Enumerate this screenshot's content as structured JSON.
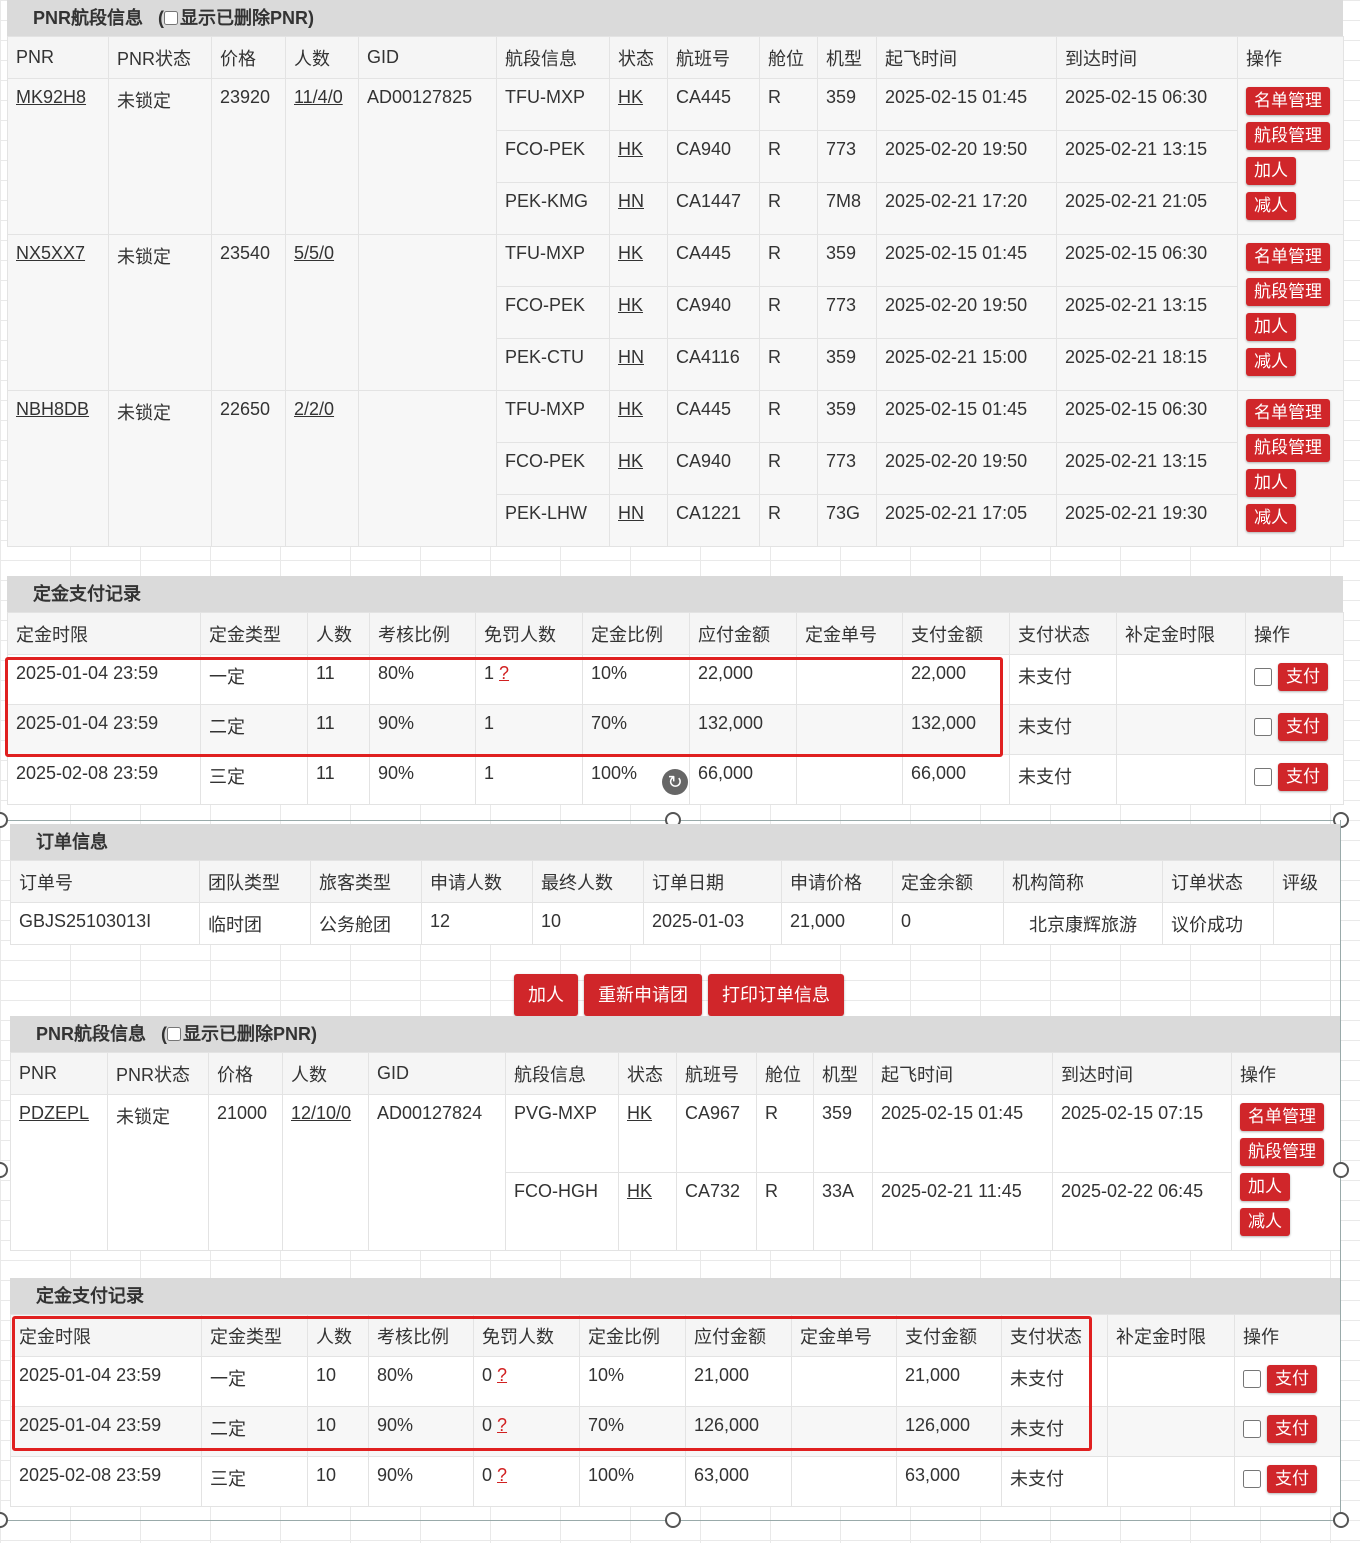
{
  "pnr1": {
    "title": "PNR航段信息",
    "show_deleted": "显示已删除PNR)",
    "headers": [
      "PNR",
      "PNR状态",
      "价格",
      "人数",
      "GID",
      "航段信息",
      "状态",
      "航班号",
      "舱位",
      "机型",
      "起飞时间",
      "到达时间",
      "操作"
    ],
    "groups": [
      {
        "pnr": "MK92H8",
        "status": "未锁定",
        "price": "23920",
        "count": "11/4/0",
        "gid": "AD00127825",
        "segs": [
          [
            "TFU-MXP",
            "HK",
            "CA445",
            "R",
            "359",
            "2025-02-15 01:45",
            "2025-02-15 06:30"
          ],
          [
            "FCO-PEK",
            "HK",
            "CA940",
            "R",
            "773",
            "2025-02-20 19:50",
            "2025-02-21 13:15"
          ],
          [
            "PEK-KMG",
            "HN",
            "CA1447",
            "R",
            "7M8",
            "2025-02-21 17:20",
            "2025-02-21 21:05"
          ]
        ]
      },
      {
        "pnr": "NX5XX7",
        "status": "未锁定",
        "price": "23540",
        "count": "5/5/0",
        "gid": "",
        "segs": [
          [
            "TFU-MXP",
            "HK",
            "CA445",
            "R",
            "359",
            "2025-02-15 01:45",
            "2025-02-15 06:30"
          ],
          [
            "FCO-PEK",
            "HK",
            "CA940",
            "R",
            "773",
            "2025-02-20 19:50",
            "2025-02-21 13:15"
          ],
          [
            "PEK-CTU",
            "HN",
            "CA4116",
            "R",
            "359",
            "2025-02-21 15:00",
            "2025-02-21 18:15"
          ]
        ]
      },
      {
        "pnr": "NBH8DB",
        "status": "未锁定",
        "price": "22650",
        "count": "2/2/0",
        "gid": "",
        "segs": [
          [
            "TFU-MXP",
            "HK",
            "CA445",
            "R",
            "359",
            "2025-02-15 01:45",
            "2025-02-15 06:30"
          ],
          [
            "FCO-PEK",
            "HK",
            "CA940",
            "R",
            "773",
            "2025-02-20 19:50",
            "2025-02-21 13:15"
          ],
          [
            "PEK-LHW",
            "HN",
            "CA1221",
            "R",
            "73G",
            "2025-02-21 17:05",
            "2025-02-21 19:30"
          ]
        ]
      }
    ],
    "ops": [
      "名单管理",
      "航段管理",
      "加人",
      "减人"
    ]
  },
  "deposit1": {
    "title": "定金支付记录",
    "headers": [
      "定金时限",
      "定金类型",
      "人数",
      "考核比例",
      "免罚人数",
      "定金比例",
      "应付金额",
      "定金单号",
      "支付金额",
      "支付状态",
      "补定金时限",
      "操作"
    ],
    "rows": [
      [
        "2025-01-04 23:59",
        "一定",
        "11",
        "80%",
        "1",
        "10%",
        "22,000",
        "",
        "22,000",
        "未支付",
        "",
        ""
      ],
      [
        "2025-01-04 23:59",
        "二定",
        "11",
        "90%",
        "1",
        "70%",
        "132,000",
        "",
        "132,000",
        "未支付",
        "",
        ""
      ],
      [
        "2025-02-08 23:59",
        "三定",
        "11",
        "90%",
        "1",
        "100%",
        "66,000",
        "",
        "66,000",
        "未支付",
        "",
        ""
      ]
    ],
    "q_mark": "?",
    "pay_label": "支付"
  },
  "order": {
    "title": "订单信息",
    "headers": [
      "订单号",
      "团队类型",
      "旅客类型",
      "申请人数",
      "最终人数",
      "订单日期",
      "申请价格",
      "定金余额",
      "机构简称",
      "订单状态",
      "评级"
    ],
    "row": [
      "GBJS25103013I",
      "临时团",
      "公务舱团",
      "12",
      "10",
      "2025-01-03",
      "21,000",
      "0",
      "北京康辉旅游",
      "议价成功",
      ""
    ],
    "buttons": [
      "加人",
      "重新申请团",
      "打印订单信息"
    ]
  },
  "pnr2": {
    "title": "PNR航段信息",
    "show_deleted": "显示已删除PNR)",
    "headers": [
      "PNR",
      "PNR状态",
      "价格",
      "人数",
      "GID",
      "航段信息",
      "状态",
      "航班号",
      "舱位",
      "机型",
      "起飞时间",
      "到达时间",
      "操作"
    ],
    "group": {
      "pnr": "PDZEPL",
      "status": "未锁定",
      "price": "21000",
      "count": "12/10/0",
      "gid": "AD00127824",
      "segs": [
        [
          "PVG-MXP",
          "HK",
          "CA967",
          "R",
          "359",
          "2025-02-15 01:45",
          "2025-02-15 07:15"
        ],
        [
          "FCO-HGH",
          "HK",
          "CA732",
          "R",
          "33A",
          "2025-02-21 11:45",
          "2025-02-22 06:45"
        ]
      ]
    },
    "ops": [
      "名单管理",
      "航段管理",
      "加人",
      "减人"
    ]
  },
  "deposit2": {
    "title": "定金支付记录",
    "headers": [
      "定金时限",
      "定金类型",
      "人数",
      "考核比例",
      "免罚人数",
      "定金比例",
      "应付金额",
      "定金单号",
      "支付金额",
      "支付状态",
      "补定金时限",
      "操作"
    ],
    "rows": [
      [
        "2025-01-04 23:59",
        "一定",
        "10",
        "80%",
        "0",
        "10%",
        "21,000",
        "",
        "21,000",
        "未支付",
        "",
        ""
      ],
      [
        "2025-01-04 23:59",
        "二定",
        "10",
        "90%",
        "0",
        "70%",
        "126,000",
        "",
        "126,000",
        "未支付",
        "",
        ""
      ],
      [
        "2025-02-08 23:59",
        "三定",
        "10",
        "90%",
        "0",
        "100%",
        "63,000",
        "",
        "63,000",
        "未支付",
        "",
        ""
      ]
    ],
    "q_mark": "?",
    "pay_label": "支付"
  },
  "colors": {
    "accent_red": "#d0262a",
    "highlight_box": "#e02020",
    "header_bg": "#dadada"
  }
}
